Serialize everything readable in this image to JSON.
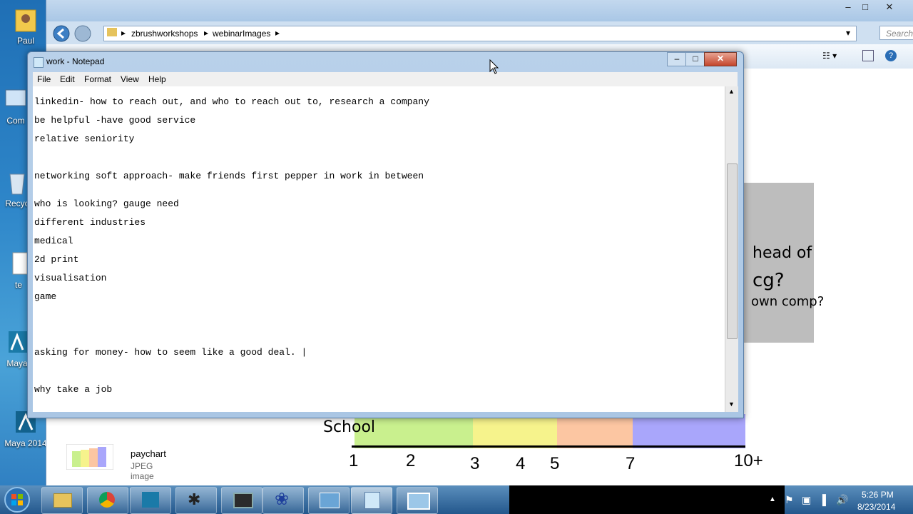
{
  "desktop": {
    "icons": [
      {
        "label": "Paul",
        "icon": "user-folder-icon"
      },
      {
        "label": "Com",
        "icon": "computer-icon"
      },
      {
        "label": "Recyc",
        "icon": "recycle-bin-icon"
      },
      {
        "label": "te",
        "icon": "file-icon"
      },
      {
        "label": "Maya",
        "icon": "maya-icon"
      },
      {
        "label": "Maya 2014",
        "icon": "maya-icon"
      }
    ]
  },
  "explorer": {
    "breadcrumb": [
      "zbrushworkshops",
      "webinarImages"
    ],
    "search_placeholder": "Search web...",
    "selected_file": {
      "name": "paychart",
      "type": "JPEG image"
    },
    "preview": {
      "labels": [
        "head of",
        "cg?",
        "own comp?"
      ],
      "axis_label": "School",
      "ticks": [
        "1",
        "2",
        "3",
        "4",
        "5",
        "7",
        "10+"
      ],
      "band_colors": [
        "#c9f08e",
        "#f6f38c",
        "#fcc6a2",
        "#a9a6fb"
      ]
    }
  },
  "notepad": {
    "title": "work - Notepad",
    "menu": [
      "File",
      "Edit",
      "Format",
      "View",
      "Help"
    ],
    "lines": [
      "linkedin- how to reach out, and who to reach out to, research a company",
      "be helpful -have good service",
      "relative seniority",
      "",
      "networking soft approach- make friends first pepper in work in between",
      "who is looking? gauge need",
      "different industries",
      "medical",
      "2d print",
      "visualisation",
      "game",
      "",
      "",
      "asking for money- how to seem like a good deal. |",
      "",
      "why take a job"
    ]
  },
  "taskbar": {
    "clock_time": "5:26 PM",
    "clock_date": "8/23/2014",
    "apps": [
      "start-icon",
      "explorer-icon",
      "chrome-icon",
      "maya-icon",
      "zbrush-icon",
      "monitor-icon",
      "flower-icon",
      "remote-icon",
      "notepad-icon",
      "image-viewer-icon"
    ]
  }
}
